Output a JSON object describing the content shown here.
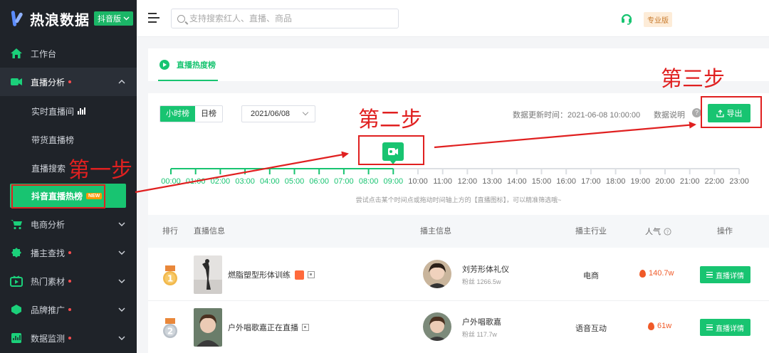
{
  "sidebar": {
    "logo_text": "热浪数据",
    "platform_badge": "抖音版",
    "items": [
      {
        "label": "工作台",
        "icon": "home-icon",
        "dot": false,
        "chevron": ""
      },
      {
        "label": "直播分析",
        "icon": "live-tv-icon",
        "dot": true,
        "chevron": "up"
      },
      {
        "label": "电商分析",
        "icon": "cart-icon",
        "dot": false,
        "chevron": "down"
      },
      {
        "label": "播主查找",
        "icon": "badge-icon",
        "dot": true,
        "chevron": "down"
      },
      {
        "label": "热门素材",
        "icon": "video-icon",
        "dot": true,
        "chevron": "down"
      },
      {
        "label": "品牌推广",
        "icon": "brand-icon",
        "dot": true,
        "chevron": "down"
      },
      {
        "label": "数据监测",
        "icon": "monitor-icon",
        "dot": true,
        "chevron": "down"
      }
    ],
    "sub_items": [
      "实时直播间",
      "带货直播榜",
      "直播搜索",
      "抖音直播热榜"
    ],
    "new_badge": "NEW"
  },
  "topbar": {
    "search_placeholder": "支持搜索红人、直播、商品",
    "pro_badge": "专业版"
  },
  "tabs": {
    "active": "直播热度榜"
  },
  "toolbar": {
    "range_options": [
      "小时榜",
      "日榜"
    ],
    "range_selected": "小时榜",
    "date_value": "2021/06/08",
    "update_time": "数据更新时间：2021-06-08 10:00:00",
    "data_desc": "数据说明",
    "export_label": "导出"
  },
  "timeline": {
    "hours": [
      "00:00",
      "01:00",
      "02:00",
      "03:00",
      "04:00",
      "05:00",
      "06:00",
      "07:00",
      "08:00",
      "09:00",
      "10:00",
      "11:00",
      "12:00",
      "13:00",
      "14:00",
      "15:00",
      "16:00",
      "17:00",
      "18:00",
      "19:00",
      "20:00",
      "21:00",
      "22:00",
      "23:00"
    ],
    "active_until_index": 9,
    "hint": "尝试点击某个时间点或拖动时间轴上方的【直播图标】，可以精准筛选哦~"
  },
  "table": {
    "headers": [
      "排行",
      "直播信息",
      "播主信息",
      "播主行业",
      "人气",
      "操作"
    ],
    "rows": [
      {
        "rank": "1",
        "live_title": "燃脂塑型形体训练",
        "host": "刘芳形体礼仪",
        "fans": "粉丝 1266.5w",
        "industry": "电商",
        "popularity": "140.7w",
        "action": "直播详情"
      },
      {
        "rank": "2",
        "live_title": "户外唱歌嘉正在直播",
        "host": "户外唱歌嘉",
        "fans": "粉丝 117.7w",
        "industry": "语音互动",
        "popularity": "61w",
        "action": "直播详情"
      }
    ]
  },
  "annotations": {
    "step1": "第一步",
    "step2": "第二步",
    "step3": "第三步"
  },
  "colors": {
    "accent": "#18c471",
    "sidebar_bg": "#1f2329",
    "annotation": "#e02020",
    "popularity": "#f05a28"
  }
}
